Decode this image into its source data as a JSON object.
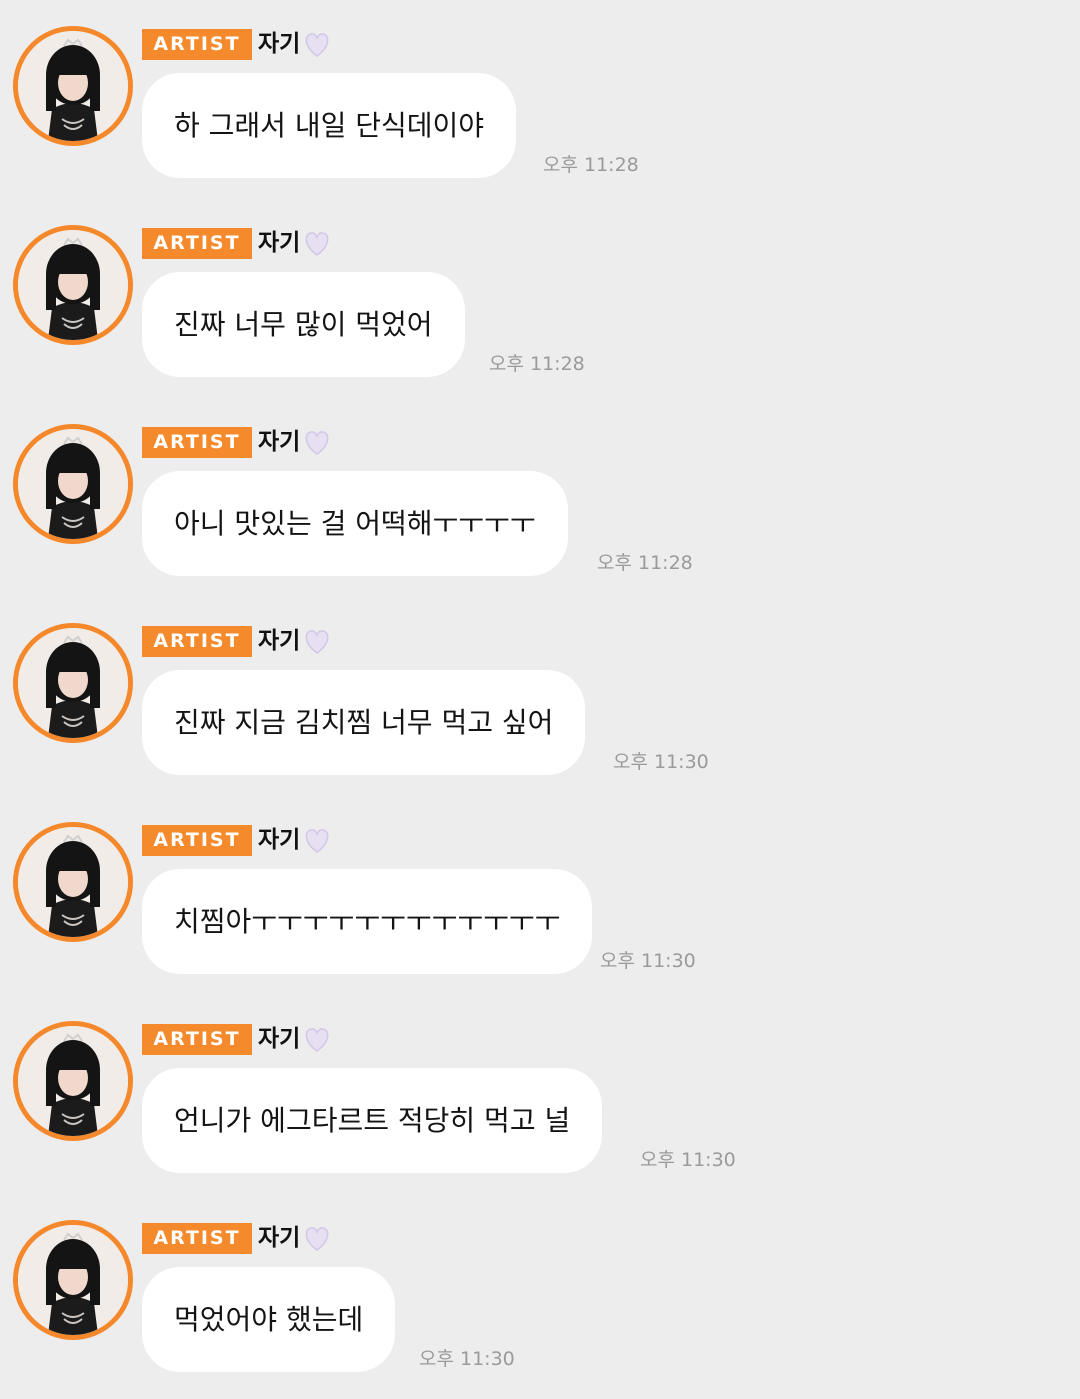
{
  "messages": [
    {
      "badge": "ARTIST",
      "sender": "자기",
      "text": "하 그래서 내일 단식데이야",
      "time": "오후 11:28"
    },
    {
      "badge": "ARTIST",
      "sender": "자기",
      "text": "진짜 너무 많이 먹었어",
      "time": "오후 11:28"
    },
    {
      "badge": "ARTIST",
      "sender": "자기",
      "text": "아니 맛있는 걸 어떡해ㅜㅜㅜㅜ",
      "time": "오후 11:28"
    },
    {
      "badge": "ARTIST",
      "sender": "자기",
      "text": "진짜 지금 김치찜 너무 먹고 싶어",
      "time": "오후 11:30"
    },
    {
      "badge": "ARTIST",
      "sender": "자기",
      "text": "치찜아ㅜㅜㅜㅜㅜㅜㅜㅜㅜㅜㅜㅜ",
      "time": "오후 11:30"
    },
    {
      "badge": "ARTIST",
      "sender": "자기",
      "text": "언니가 에그타르트 적당히 먹고 널",
      "time": "오후 11:30"
    },
    {
      "badge": "ARTIST",
      "sender": "자기",
      "text": "먹었어야 했는데",
      "time": "오후 11:30"
    }
  ],
  "colors": {
    "background": "#ededed",
    "badge": "#f58a2c",
    "avatar_ring": "#f4882a",
    "bubble": "#ffffff",
    "time": "#9a9a9a",
    "heart": "#e7e0f3"
  },
  "icons": {
    "avatar": "profile-photo",
    "heart": "white-heart-icon"
  }
}
